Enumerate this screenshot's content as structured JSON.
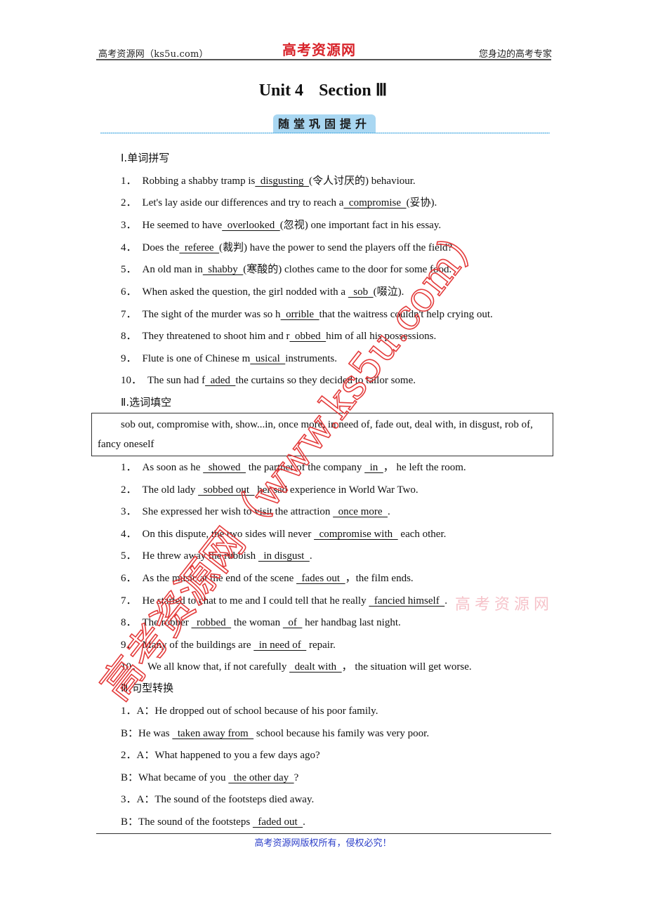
{
  "header": {
    "left": "高考资源网（ks5u.com）",
    "logo": "高考资源网",
    "right": "您身边的高考专家"
  },
  "title": {
    "unit": "Unit 4",
    "section": "Section Ⅲ"
  },
  "banner": "随堂巩固提升",
  "part1": {
    "heading": "Ⅰ.单词拼写",
    "items": [
      {
        "num": "1．",
        "pre": "Robbing a shabby tramp is",
        "answer": "  disgusting  ",
        "post": "(令人讨厌的) behaviour."
      },
      {
        "num": "2．",
        "pre": "Let's lay aside our differences and try to reach a",
        "answer": "  compromise  ",
        "post": "(妥协)."
      },
      {
        "num": "3．",
        "pre": "He seemed to have",
        "answer": "  overlooked  ",
        "post": "(忽视) one important fact in his essay."
      },
      {
        "num": "4．",
        "pre": "Does the",
        "answer": "  referee  ",
        "post": "(裁判) have the power to send the players off the field?"
      },
      {
        "num": "5．",
        "pre": "An old man in",
        "answer": "  shabby  ",
        "post": "(寒酸的) clothes came to the door for some food."
      },
      {
        "num": "6．",
        "pre": "When asked the question, the girl nodded with a ",
        "answer": "  sob  ",
        "post": "(啜泣)."
      },
      {
        "num": "7．",
        "pre": "The sight of the murder was so h",
        "answer": "  orrible  ",
        "post": "that the waitress couldn't help crying out."
      },
      {
        "num": "8．",
        "pre": "They threatened to shoot him and r",
        "answer": "  obbed  ",
        "post": "him of all his possessions."
      },
      {
        "num": "9．",
        "pre": "Flute is one of Chinese m",
        "answer": "  usical  ",
        "post": "instruments."
      },
      {
        "num": "10．",
        "pre": "The sun had f",
        "answer": "  aded  ",
        "post": "the curtains so they decided to tailor some."
      }
    ]
  },
  "part2": {
    "heading": "Ⅱ.选词填空",
    "word_box": "sob out, compromise with, show...in, once more, in need of, fade out, deal with, in disgust, rob of, fancy oneself",
    "items": [
      {
        "num": "1．",
        "segments": [
          "As soon as he ",
          "  showed  ",
          " the partner of the company ",
          "  in  ",
          "，  he left the room."
        ]
      },
      {
        "num": "2．",
        "segments": [
          "The old lady ",
          "  sobbed out  ",
          " her sad experience in World War Two."
        ]
      },
      {
        "num": "3．",
        "segments": [
          "She expressed her wish to visit the attraction ",
          "  once more  ",
          "."
        ]
      },
      {
        "num": "4．",
        "segments": [
          "On this dispute, the two sides will never ",
          "  compromise with  ",
          " each other."
        ]
      },
      {
        "num": "5．",
        "segments": [
          "He threw away the rubbish ",
          "  in disgust  ",
          "."
        ]
      },
      {
        "num": "6．",
        "segments": [
          "As the music at the end of the scene ",
          "  fades out  ",
          "，the film ends."
        ]
      },
      {
        "num": "7．",
        "segments": [
          "He started to chat to me and I could tell that he really ",
          "  fancied himself  ",
          "."
        ]
      },
      {
        "num": "8．",
        "segments": [
          "The robber ",
          "  robbed  ",
          " the woman ",
          "  of  ",
          " her handbag last night."
        ]
      },
      {
        "num": "9．",
        "segments": [
          "Many of the buildings are ",
          "  in need of  ",
          " repair."
        ]
      },
      {
        "num": "10．",
        "segments": [
          "We all know that, if not carefully ",
          "  dealt with  ",
          "，  the situation will get worse."
        ]
      }
    ]
  },
  "part3": {
    "heading": "Ⅲ.句型转换",
    "items": [
      {
        "a_label": "1．A：",
        "a_text": "He dropped out of school because of his poor family.",
        "b_label": "B：",
        "b_pre": "He was ",
        "b_answer": "  taken away from  ",
        "b_post": " school because his family was very poor."
      },
      {
        "a_label": "2．A：",
        "a_text": "What happened to you a few days ago?",
        "b_label": "B：",
        "b_pre": "What became of you ",
        "b_answer": "  the other day  ",
        "b_post": "?"
      },
      {
        "a_label": "3．A：",
        "a_text": "The sound of the footsteps died away.",
        "b_label": "B：",
        "b_pre": "The sound of the footsteps ",
        "b_answer": "  faded out  ",
        "b_post": "."
      }
    ]
  },
  "footer": "高考资源网版权所有，侵权必究！",
  "watermark": {
    "main": "高考资源网（www.ks5u.com）",
    "small": "高考资源网",
    "color": "#e43b3b"
  }
}
